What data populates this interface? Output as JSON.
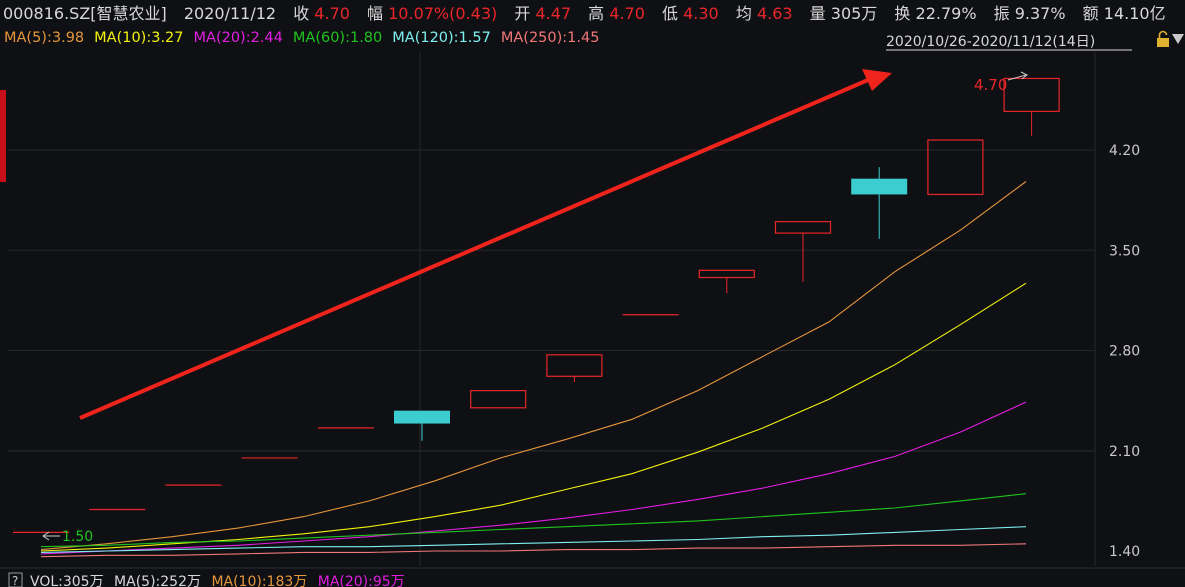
{
  "header": {
    "symbol": "000816.SZ[智慧农业]",
    "date": "2020/11/12",
    "close_label": "收",
    "close": "4.70",
    "change_label": "幅",
    "change": "10.07%(0.43)",
    "open_label": "开",
    "open": "4.47",
    "high_label": "高",
    "high": "4.70",
    "low_label": "低",
    "low": "4.30",
    "avg_label": "均",
    "avg": "4.63",
    "volume_label": "量",
    "volume": "305万",
    "turnover_label": "换",
    "turnover": "22.79%",
    "amplitude_label": "振",
    "amplitude": "9.37%",
    "amount_label": "额",
    "amount": "14.10亿"
  },
  "ma_legend": [
    {
      "label": "MA(5):3.98",
      "color": "#e5963c"
    },
    {
      "label": "MA(10):3.27",
      "color": "#f2f20f"
    },
    {
      "label": "MA(20):2.44",
      "color": "#e21ee2"
    },
    {
      "label": "MA(60):1.80",
      "color": "#1fc41f"
    },
    {
      "label": "MA(120):1.57",
      "color": "#7ff0f0"
    },
    {
      "label": "MA(250):1.45",
      "color": "#f07878"
    }
  ],
  "range_label": "2020/10/26-2020/11/12(14日)",
  "range_icons": [
    "lock-icon",
    "dropdown-arrow-icon"
  ],
  "bottom": {
    "help": "?",
    "vol": "VOL:305万",
    "ma5": "MA(5):252万",
    "ma10": "MA(10):183万",
    "ma20": "MA(20):95万"
  },
  "colors": {
    "up": "#e8262a",
    "down": "#3ccdd0",
    "grid": "#24272c",
    "arrow": "#f0241c",
    "axis_text": "#c9c9c9"
  },
  "chart_data": {
    "type": "candlestick",
    "y_ticks": [
      "4.20",
      "3.50",
      "2.80",
      "2.10",
      "1.40"
    ],
    "ylim": [
      1.4,
      4.85
    ],
    "high_annotation": "4.70",
    "low_annotation": "1.50",
    "candles": [
      {
        "o": 1.53,
        "h": 1.53,
        "l": 1.53,
        "c": 1.53
      },
      {
        "o": 1.69,
        "h": 1.69,
        "l": 1.69,
        "c": 1.69
      },
      {
        "o": 1.86,
        "h": 1.86,
        "l": 1.86,
        "c": 1.86
      },
      {
        "o": 2.05,
        "h": 2.05,
        "l": 2.05,
        "c": 2.05
      },
      {
        "o": 2.26,
        "h": 2.26,
        "l": 2.26,
        "c": 2.26
      },
      {
        "o": 2.38,
        "h": 2.38,
        "l": 2.17,
        "c": 2.29
      },
      {
        "o": 2.4,
        "h": 2.52,
        "l": 2.4,
        "c": 2.52
      },
      {
        "o": 2.62,
        "h": 2.77,
        "l": 2.58,
        "c": 2.77
      },
      {
        "o": 3.05,
        "h": 3.05,
        "l": 3.05,
        "c": 3.05
      },
      {
        "o": 3.31,
        "h": 3.36,
        "l": 3.2,
        "c": 3.36
      },
      {
        "o": 3.62,
        "h": 3.7,
        "l": 3.28,
        "c": 3.7
      },
      {
        "o": 4.0,
        "h": 4.08,
        "l": 3.58,
        "c": 3.89
      },
      {
        "o": 3.89,
        "h": 4.27,
        "l": 3.89,
        "c": 4.27
      },
      {
        "o": 4.47,
        "h": 4.7,
        "l": 4.3,
        "c": 4.7
      }
    ],
    "ma_series": [
      {
        "name": "MA(5)",
        "values": [
          1.41,
          1.45,
          1.5,
          1.56,
          1.64,
          1.75,
          1.89,
          2.05,
          2.18,
          2.32,
          2.52,
          2.76,
          3.0,
          3.35,
          3.64,
          3.98
        ]
      },
      {
        "name": "MA(10)",
        "values": [
          1.4,
          1.42,
          1.45,
          1.48,
          1.52,
          1.57,
          1.64,
          1.72,
          1.83,
          1.94,
          2.09,
          2.26,
          2.46,
          2.7,
          2.98,
          3.27
        ]
      },
      {
        "name": "MA(20)",
        "values": [
          1.38,
          1.4,
          1.42,
          1.44,
          1.47,
          1.5,
          1.54,
          1.58,
          1.63,
          1.69,
          1.76,
          1.84,
          1.94,
          2.06,
          2.23,
          2.44
        ]
      },
      {
        "name": "MA(60)",
        "values": [
          1.43,
          1.44,
          1.46,
          1.47,
          1.49,
          1.51,
          1.53,
          1.55,
          1.57,
          1.59,
          1.61,
          1.64,
          1.67,
          1.7,
          1.75,
          1.8
        ]
      },
      {
        "name": "MA(120)",
        "values": [
          1.39,
          1.4,
          1.41,
          1.42,
          1.43,
          1.43,
          1.44,
          1.45,
          1.46,
          1.47,
          1.48,
          1.5,
          1.51,
          1.53,
          1.55,
          1.57
        ]
      },
      {
        "name": "MA(250)",
        "values": [
          1.36,
          1.37,
          1.37,
          1.38,
          1.39,
          1.39,
          1.4,
          1.4,
          1.41,
          1.41,
          1.42,
          1.42,
          1.43,
          1.44,
          1.44,
          1.45
        ]
      }
    ]
  }
}
